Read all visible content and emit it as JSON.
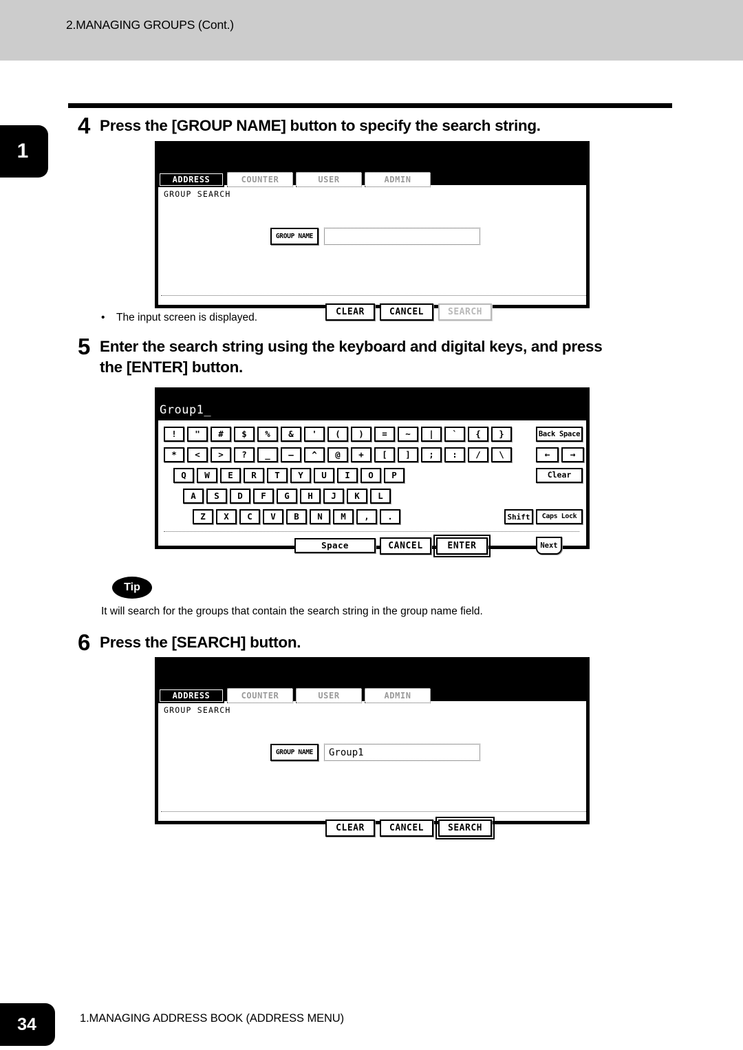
{
  "header": {
    "title": "2.MANAGING GROUPS (Cont.)",
    "chapter_tab": "1"
  },
  "footer": {
    "page_number": "34",
    "title": "1.MANAGING ADDRESS BOOK (ADDRESS MENU)"
  },
  "steps": {
    "step4": {
      "number": "4",
      "text": "Press the [GROUP NAME] button to specify the search string.",
      "note_bullet": "•",
      "note": "The input screen is displayed."
    },
    "step5": {
      "number": "5",
      "line1": "Enter the search string using the keyboard and digital keys, and press",
      "line2": "the [ENTER] button."
    },
    "step6": {
      "number": "6",
      "text": "Press the [SEARCH] button."
    }
  },
  "tip": {
    "badge": "Tip",
    "text": "It will search for the groups that contain the search string in the group name field."
  },
  "screen_empty": {
    "tabs": [
      {
        "label": "ADDRESS",
        "state": "active"
      },
      {
        "label": "COUNTER",
        "state": "inactive"
      },
      {
        "label": "USER",
        "state": "inactive"
      },
      {
        "label": "ADMIN",
        "state": "inactive"
      }
    ],
    "screen_label": "GROUP SEARCH",
    "field_button": "GROUP NAME",
    "field_value": "",
    "buttons": [
      {
        "label": "CLEAR",
        "state": "enabled"
      },
      {
        "label": "CANCEL",
        "state": "enabled"
      },
      {
        "label": "SEARCH",
        "state": "disabled"
      }
    ]
  },
  "screen_filled": {
    "tabs": [
      {
        "label": "ADDRESS",
        "state": "active"
      },
      {
        "label": "COUNTER",
        "state": "inactive"
      },
      {
        "label": "USER",
        "state": "inactive"
      },
      {
        "label": "ADMIN",
        "state": "inactive"
      }
    ],
    "screen_label": "GROUP SEARCH",
    "field_button": "GROUP NAME",
    "field_value": "Group1",
    "buttons": [
      {
        "label": "CLEAR",
        "state": "enabled"
      },
      {
        "label": "CANCEL",
        "state": "enabled"
      },
      {
        "label": "SEARCH",
        "state": "emphasis"
      }
    ]
  },
  "keyboard": {
    "display_value": "Group1_",
    "row1": [
      "!",
      "\"",
      "#",
      "$",
      "%",
      "&",
      "'",
      "(",
      ")",
      "=",
      "~",
      "|",
      "`",
      "{",
      "}"
    ],
    "row1_extra": "Back Space",
    "row2": [
      "*",
      "<",
      ">",
      "?",
      "_",
      "—",
      "^",
      "@",
      "+",
      "[",
      "]",
      ";",
      ":",
      "/",
      "\\"
    ],
    "row2_extra_left": "←",
    "row2_extra_right": "→",
    "row3": [
      "Q",
      "W",
      "E",
      "R",
      "T",
      "Y",
      "U",
      "I",
      "O",
      "P"
    ],
    "row3_extra": "Clear",
    "row4": [
      "A",
      "S",
      "D",
      "F",
      "G",
      "H",
      "J",
      "K",
      "L"
    ],
    "row5": [
      "Z",
      "X",
      "C",
      "V",
      "B",
      "N",
      "M",
      ",",
      "."
    ],
    "row5_extra_shift": "Shift",
    "row5_extra_caps": "Caps Lock",
    "space": "Space",
    "cancel": "CANCEL",
    "enter": "ENTER",
    "next": "Next"
  }
}
